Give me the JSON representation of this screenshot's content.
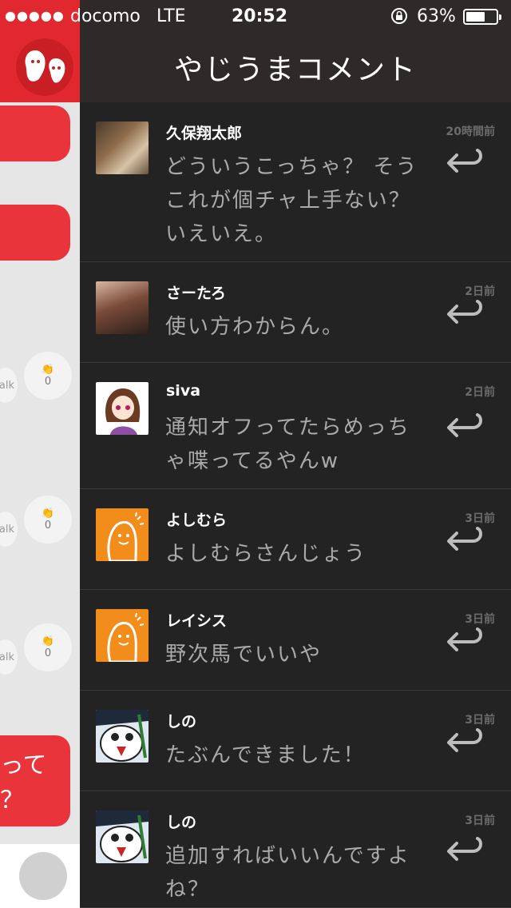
{
  "status_bar": {
    "signal": "●●●●●",
    "carrier": "docomo",
    "network": "LTE",
    "time": "20:52",
    "lock_icon": "⟳",
    "battery_percent": "63%",
    "battery_level": 0.63
  },
  "background_app": {
    "talk_label": "alk",
    "clap_counts": [
      "0",
      "0",
      "0"
    ],
    "partial_bubble_text": "って\n？",
    "colors": {
      "brand": "#e0282e",
      "bubble": "#e8343a"
    }
  },
  "panel": {
    "title": "やじうまコメント",
    "comments": [
      {
        "name": "久保翔太郎",
        "time": "20時間前",
        "text": "どういうこっちゃ？ そうこれが個チャ上手ない？いえいえ。",
        "avatar": "photo-guitar"
      },
      {
        "name": "さーたろ",
        "time": "2日前",
        "text": "使い方わからん。",
        "avatar": "photo-woman"
      },
      {
        "name": "siva",
        "time": "2日前",
        "text": "通知オフってたらめっちゃ喋ってるやんw",
        "avatar": "anime-girl"
      },
      {
        "name": "よしむら",
        "time": "3日前",
        "text": "よしむらさんじょう",
        "avatar": "default-orange"
      },
      {
        "name": "レイシス",
        "time": "3日前",
        "text": "野次馬でいいや",
        "avatar": "default-orange"
      },
      {
        "name": "しの",
        "time": "3日前",
        "text": "たぶんできました！",
        "avatar": "manga-bird"
      },
      {
        "name": "しの",
        "time": "3日前",
        "text": "追加すればいいんですよね？",
        "avatar": "manga-bird"
      }
    ]
  }
}
